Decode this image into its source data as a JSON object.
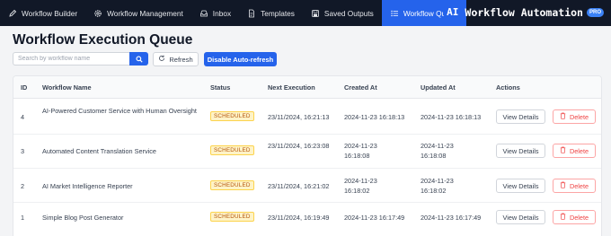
{
  "nav": {
    "items": [
      {
        "label": "Workflow Builder",
        "icon": "pencil-icon"
      },
      {
        "label": "Workflow Management",
        "icon": "gear-icon"
      },
      {
        "label": "Inbox",
        "icon": "inbox-icon"
      },
      {
        "label": "Templates",
        "icon": "document-icon"
      },
      {
        "label": "Saved Outputs",
        "icon": "save-icon"
      },
      {
        "label": "Workflow Queue",
        "icon": "list-icon",
        "active": true
      }
    ],
    "more": "···"
  },
  "brand": {
    "ai": "AI",
    "name": "Workflow Automation",
    "pro": "PRO"
  },
  "page": {
    "title": "Workflow Execution Queue"
  },
  "toolbar": {
    "search_placeholder": "Search by workflow name",
    "refresh_label": "Refresh",
    "auto_refresh_label": "Disable Auto-refresh"
  },
  "table": {
    "headers": {
      "id": "ID",
      "name": "Workflow Name",
      "status": "Status",
      "next": "Next Execution",
      "created": "Created At",
      "updated": "Updated At",
      "actions": "Actions"
    },
    "rows": [
      {
        "id": "4",
        "name": "AI-Powered Customer Service with Human Oversight",
        "status": "SCHEDULED",
        "next": "23/11/2024, 16:21:13",
        "created": "2024-11-23 16:18:13",
        "updated": "2024-11-23 16:18:13"
      },
      {
        "id": "3",
        "name": "Automated Content Translation Service",
        "status": "SCHEDULED",
        "next": "23/11/2024, 16:23:08",
        "created": "2024-11-23 16:18:08",
        "updated": "2024-11-23 16:18:08"
      },
      {
        "id": "2",
        "name": "AI Market Intelligence Reporter",
        "status": "SCHEDULED",
        "next": "23/11/2024, 16:21:02",
        "created": "2024-11-23 16:18:02",
        "updated": "2024-11-23 16:18:02"
      },
      {
        "id": "1",
        "name": "Simple Blog Post Generator",
        "status": "SCHEDULED",
        "next": "23/11/2024, 16:19:49",
        "created": "2024-11-23 16:17:49",
        "updated": "2024-11-23 16:17:49"
      }
    ],
    "view_label": "View Details",
    "delete_label": "Delete"
  },
  "colors": {
    "accent": "#2563eb",
    "nav_bg": "#111827",
    "badge": "#b45309",
    "danger": "#ef4444"
  }
}
